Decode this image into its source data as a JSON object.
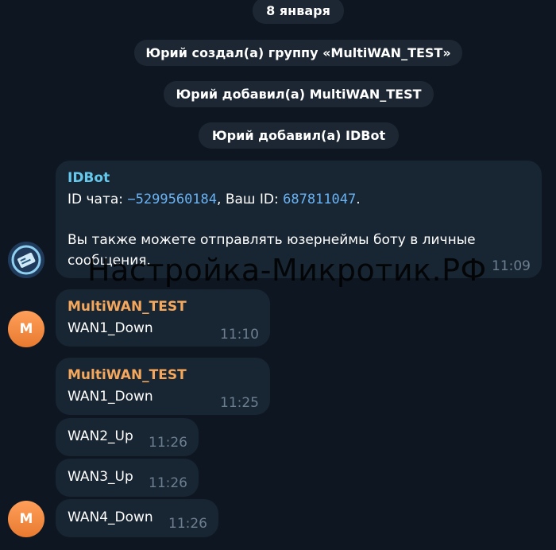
{
  "date_pill": "8 января",
  "service_messages": [
    "Юрий создал(а) группу «MultiWAN_TEST»",
    "Юрий добавил(а) MultiWAN_TEST",
    "Юрий добавил(а) IDBot"
  ],
  "idbot_message": {
    "sender": "IDBot",
    "line1_prefix": "ID чата: ",
    "chat_id": "−5299560184",
    "line1_mid": ", Ваш ID: ",
    "user_id": "687811047",
    "line1_suffix": ".",
    "line2": "Вы также можете отправлять юзернеймы боту в личные",
    "line3": "сообщения.",
    "time": "11:09"
  },
  "group_messages": [
    {
      "sender": "MultiWAN_TEST",
      "text": "WAN1_Down",
      "time": "11:10"
    },
    {
      "sender": "MultiWAN_TEST",
      "text": "WAN1_Down",
      "time": "11:25"
    },
    {
      "text": "WAN2_Up",
      "time": "11:26"
    },
    {
      "text": "WAN3_Up",
      "time": "11:26"
    },
    {
      "text": "WAN4_Down",
      "time": "11:26"
    }
  ],
  "avatar_letter": "M",
  "watermark": "Настройка-Микротик.РФ",
  "colors": {
    "background": "#0e1621",
    "bubble": "#182533",
    "bot_name": "#64c9ec",
    "group_name": "#f5a85c",
    "link": "#6ab3f3",
    "time": "#6d7f8f",
    "avatar_orange": "#f08a40"
  }
}
